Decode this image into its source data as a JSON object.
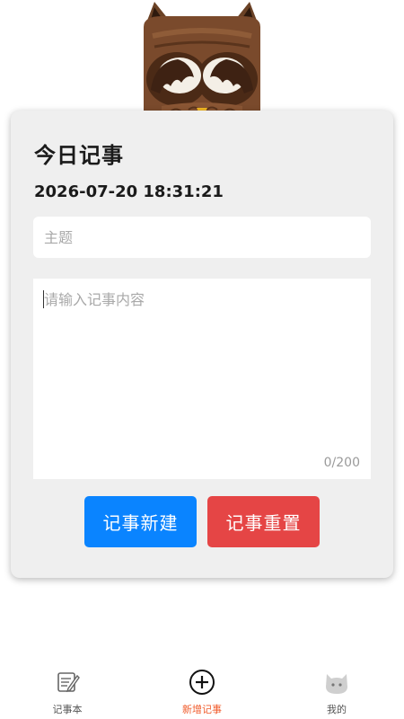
{
  "card": {
    "title": "今日记事",
    "datetime": "2026-07-20 18:31:21"
  },
  "form": {
    "subject_placeholder": "主题",
    "content_placeholder": "请输入记事内容",
    "counter": "0/200"
  },
  "buttons": {
    "create_label": "记事新建",
    "reset_label": "记事重置"
  },
  "tabbar": {
    "items": [
      {
        "label": "记事本",
        "icon": "notebook-icon"
      },
      {
        "label": "新增记事",
        "icon": "plus-circle-icon",
        "active": true
      },
      {
        "label": "我的",
        "icon": "cat-face-icon"
      }
    ]
  },
  "colors": {
    "create_button": "#0a84ff",
    "reset_button": "#e54545",
    "active_tab": "#f05a2a",
    "card_bg": "#efefef"
  }
}
